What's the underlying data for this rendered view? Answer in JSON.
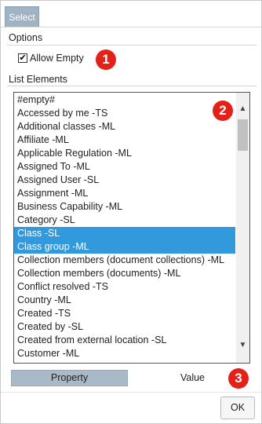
{
  "tab": {
    "label": "Select"
  },
  "options": {
    "title": "Options",
    "allow_empty": {
      "label": "Allow Empty",
      "checked": true
    }
  },
  "list": {
    "title": "List Elements",
    "items": [
      {
        "label": "#empty#",
        "selected": false
      },
      {
        "label": "Accessed by me -TS",
        "selected": false
      },
      {
        "label": "Additional classes -ML",
        "selected": false
      },
      {
        "label": "Affiliate -ML",
        "selected": false
      },
      {
        "label": "Applicable Regulation -ML",
        "selected": false
      },
      {
        "label": "Assigned To -ML",
        "selected": false
      },
      {
        "label": "Assigned User -SL",
        "selected": false
      },
      {
        "label": "Assignment -ML",
        "selected": false
      },
      {
        "label": "Business Capability -ML",
        "selected": false
      },
      {
        "label": "Category -SL",
        "selected": false
      },
      {
        "label": "Class -SL",
        "selected": true
      },
      {
        "label": "Class group -ML",
        "selected": true
      },
      {
        "label": "Collection members (document collections) -ML",
        "selected": false
      },
      {
        "label": "Collection members (documents) -ML",
        "selected": false
      },
      {
        "label": "Conflict resolved -TS",
        "selected": false
      },
      {
        "label": "Country -ML",
        "selected": false
      },
      {
        "label": "Created -TS",
        "selected": false
      },
      {
        "label": "Created by -SL",
        "selected": false
      },
      {
        "label": "Created from external location -SL",
        "selected": false
      },
      {
        "label": "Customer -ML",
        "selected": false
      }
    ]
  },
  "buttons": {
    "property": "Property",
    "value": "Value",
    "ok": "OK"
  },
  "badges": [
    "1",
    "2",
    "3"
  ],
  "colors": {
    "selection": "#3399dd",
    "badge": "#e32119",
    "tab": "#9fb3c3"
  }
}
